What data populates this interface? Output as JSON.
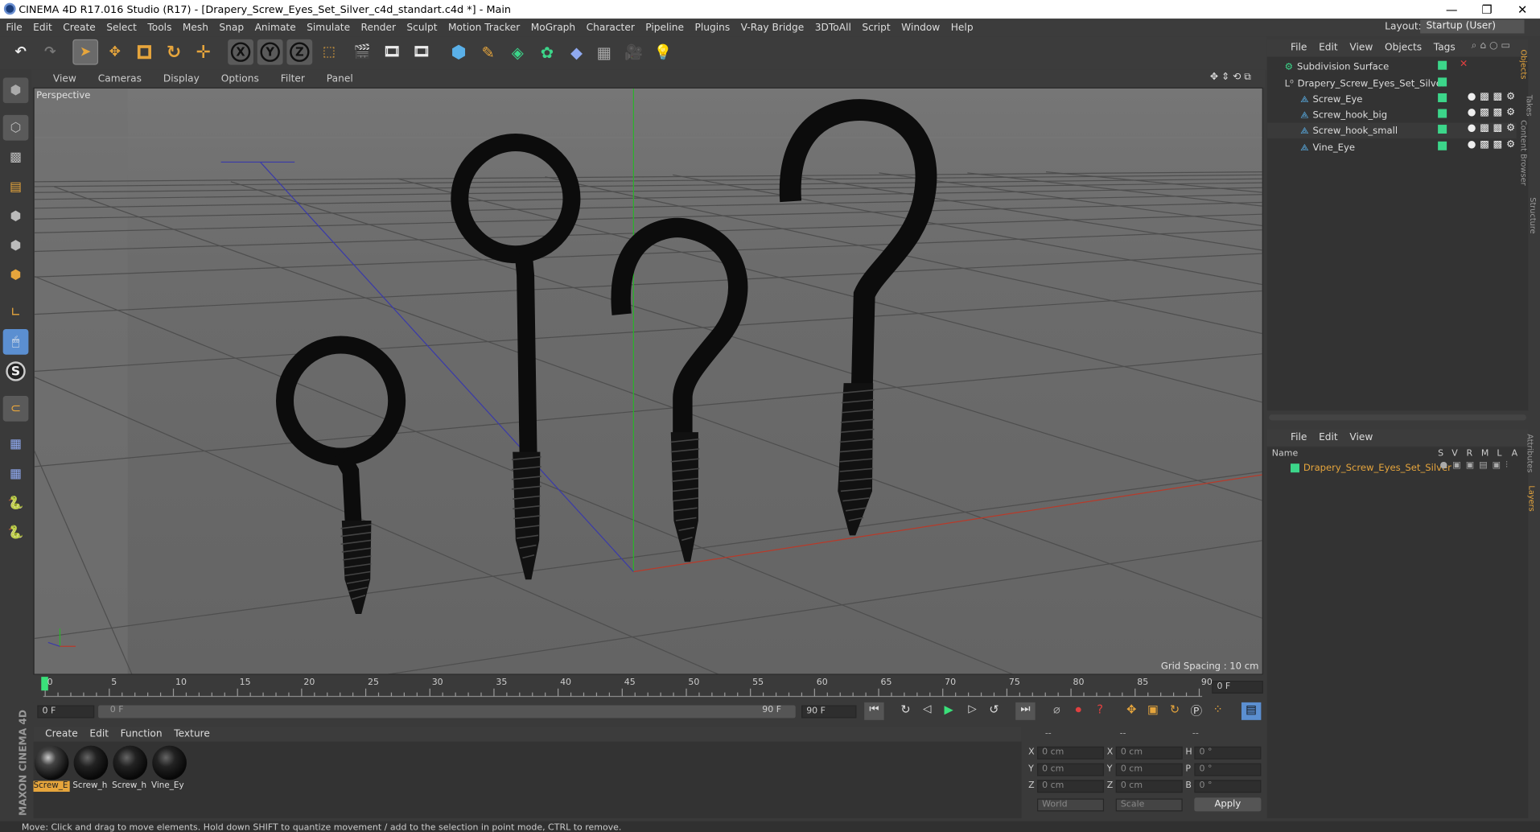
{
  "window": {
    "title": "CINEMA 4D R17.016 Studio (R17) - [Drapery_Screw_Eyes_Set_Silver_c4d_standart.c4d *] - Main",
    "min": "—",
    "max": "❐",
    "close": "✕"
  },
  "menu": [
    "File",
    "Edit",
    "Create",
    "Select",
    "Tools",
    "Mesh",
    "Snap",
    "Animate",
    "Simulate",
    "Render",
    "Sculpt",
    "Motion Tracker",
    "MoGraph",
    "Character",
    "Pipeline",
    "Plugins",
    "V-Ray Bridge",
    "3DToAll",
    "Script",
    "Window",
    "Help"
  ],
  "layout": {
    "label": "Layout:",
    "value": "Startup (User)"
  },
  "toolbar": {
    "x": "X",
    "y": "Y",
    "z": "Z"
  },
  "viewport": {
    "menu": [
      "View",
      "Cameras",
      "Display",
      "Options",
      "Filter",
      "Panel"
    ],
    "label": "Perspective",
    "grid_spacing": "Grid Spacing : 10 cm"
  },
  "objects": {
    "menu": [
      "File",
      "Edit",
      "View",
      "Objects",
      "Tags"
    ],
    "items": [
      {
        "name": "Subdivision Surface",
        "sel": false
      },
      {
        "name": "Drapery_Screw_Eyes_Set_Silver",
        "sel": false
      },
      {
        "name": "Screw_Eye",
        "sel": false
      },
      {
        "name": "Screw_hook_big",
        "sel": false
      },
      {
        "name": "Screw_hook_small",
        "sel": true
      },
      {
        "name": "Vine_Eye",
        "sel": false
      }
    ]
  },
  "side_tabs": [
    "Objects",
    "Takes",
    "Content Browser",
    "Structure",
    "Attributes",
    "Layers"
  ],
  "layers": {
    "menu": [
      "File",
      "Edit",
      "View"
    ],
    "cols": {
      "name": "Name",
      "s": "S",
      "v": "V",
      "r": "R",
      "m": "M",
      "l": "L",
      "a": "A"
    },
    "item": "Drapery_Screw_Eyes_Set_Silver"
  },
  "timeline": {
    "ticks": [
      "0",
      "5",
      "10",
      "15",
      "20",
      "25",
      "30",
      "35",
      "40",
      "45",
      "50",
      "55",
      "60",
      "65",
      "70",
      "75",
      "80",
      "85",
      "90"
    ],
    "end_field": "0 F",
    "start": "0 F",
    "slider_start": "0 F",
    "slider_end": "90 F",
    "max": "90 F"
  },
  "materials": {
    "menu": [
      "Create",
      "Edit",
      "Function",
      "Texture"
    ],
    "items": [
      "Screw_E",
      "Screw_h",
      "Screw_h",
      "Vine_Ey"
    ]
  },
  "coords": {
    "dashes": [
      "--",
      "--",
      "--"
    ],
    "pos": [
      {
        "axis": "X",
        "val": "0 cm"
      },
      {
        "axis": "Y",
        "val": "0 cm"
      },
      {
        "axis": "Z",
        "val": "0 cm"
      }
    ],
    "size": [
      {
        "axis": "X",
        "val": "0 cm"
      },
      {
        "axis": "Y",
        "val": "0 cm"
      },
      {
        "axis": "Z",
        "val": "0 cm"
      }
    ],
    "rot": [
      {
        "axis": "H",
        "val": "0 °"
      },
      {
        "axis": "P",
        "val": "0 °"
      },
      {
        "axis": "B",
        "val": "0 °"
      }
    ],
    "world": "World",
    "scale": "Scale",
    "apply": "Apply"
  },
  "brand": "MAXON CINEMA 4D",
  "status": "Move: Click and drag to move elements. Hold down SHIFT to quantize movement / add to the selection in point mode, CTRL to remove."
}
